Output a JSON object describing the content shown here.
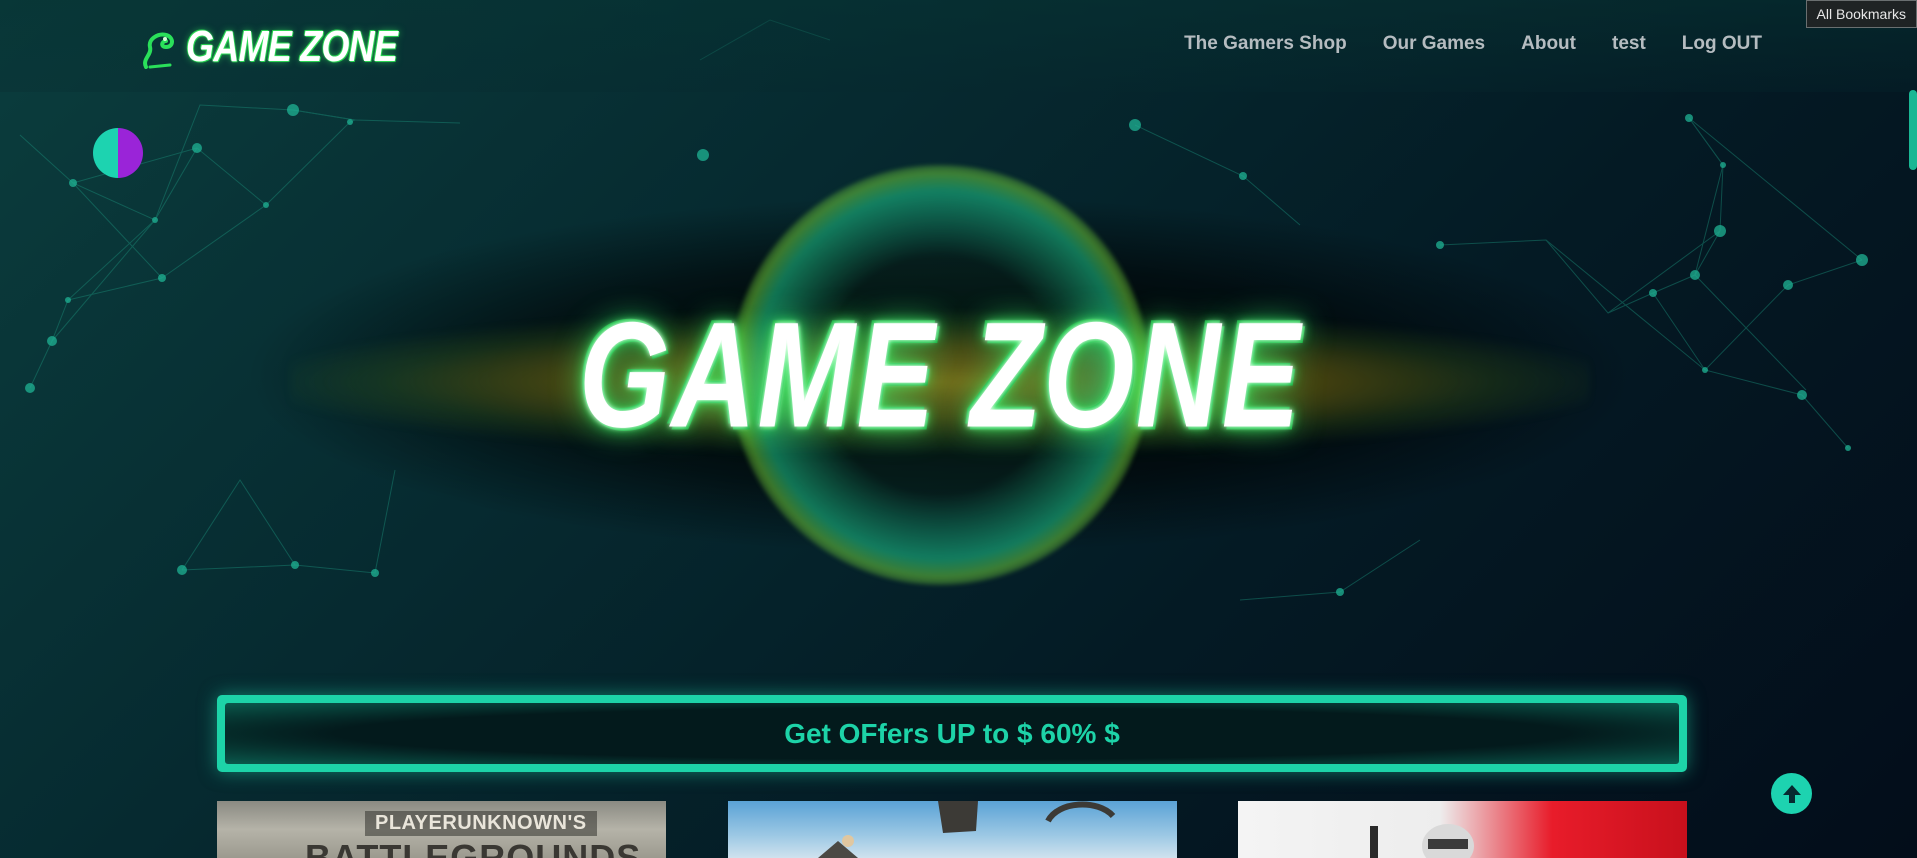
{
  "header": {
    "logo_text": "GAME ZONE",
    "nav": [
      "The Gamers Shop",
      "Our Games",
      "About",
      "test",
      "Log OUT"
    ]
  },
  "browser": {
    "bookmarks_label": "All Bookmarks"
  },
  "hero": {
    "title": "GAME ZONE"
  },
  "offer": {
    "text": "Get OFfers UP to $ 60% $"
  },
  "cards": [
    {
      "title_line1": "PLAYERUNKNOWN'S",
      "title_line2": "BATTLEGROUNDS"
    },
    {
      "title_line1": "",
      "title_line2": ""
    },
    {
      "title_line1": "",
      "title_line2": ""
    }
  ],
  "icons": {
    "logo": "snake-icon",
    "theme_toggle": "theme-toggle-icon",
    "back_to_top": "arrow-up-icon"
  },
  "colors": {
    "accent": "#1dd3a8",
    "toggle_purple": "#9a24d8",
    "nav_text": "#b5bcc0",
    "logo_glow": "#33ff66"
  }
}
